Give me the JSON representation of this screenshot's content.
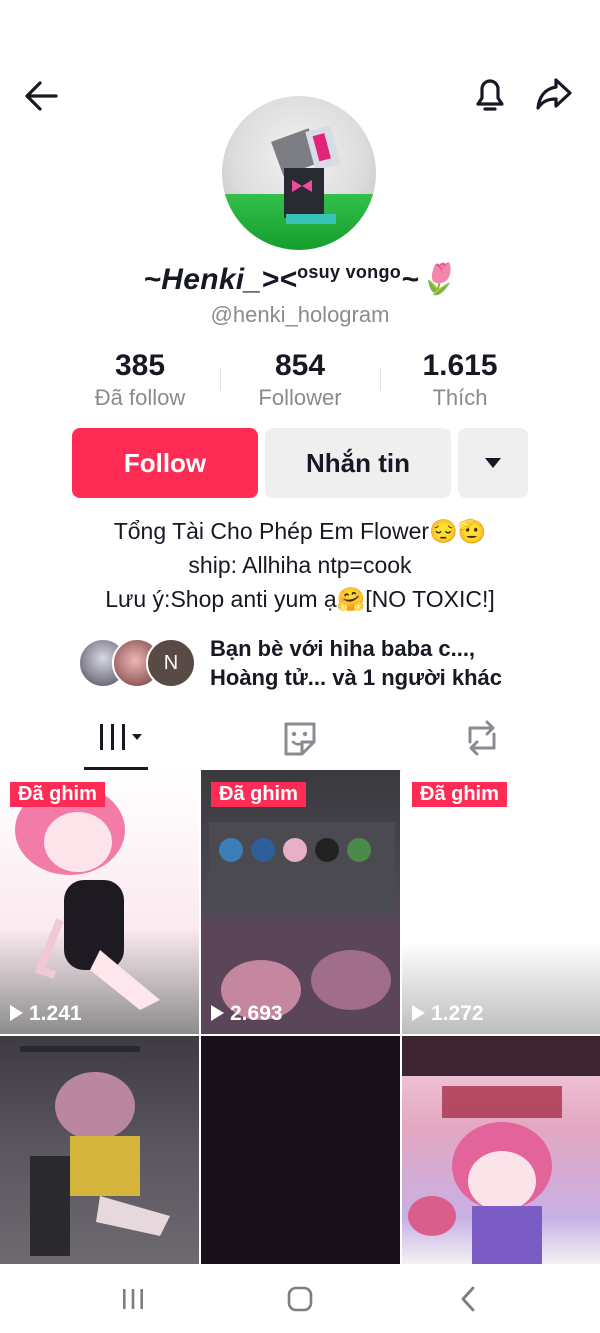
{
  "profile": {
    "display_name": "~Henki_><",
    "display_name_sup": "osuy vongo",
    "display_name_tail": "~🌷",
    "handle": "@henki_hologram"
  },
  "stats": [
    {
      "value": "385",
      "label": "Đã follow"
    },
    {
      "value": "854",
      "label": "Follower"
    },
    {
      "value": "1.615",
      "label": "Thích"
    }
  ],
  "actions": {
    "follow_label": "Follow",
    "message_label": "Nhắn tin"
  },
  "bio": {
    "line1": "Tổng Tài Cho Phép Em Flower😔🫡",
    "line2": "ship: Allhiha ntp=cook",
    "line3": "Lưu ý:Shop anti yum ạ🤗[NO TOXIC!]"
  },
  "friends": {
    "avatar_initial": "N",
    "line1": "Bạn bè với hiha baba c...,",
    "line2": "Hoàng tử... và 1 người khác"
  },
  "tabs": [
    {
      "icon": "grid-icon"
    },
    {
      "icon": "sticker-icon"
    },
    {
      "icon": "repost-icon"
    }
  ],
  "videos": [
    {
      "pinned_label": "Đã ghim",
      "views": "1.241"
    },
    {
      "pinned_label": "Đã ghim",
      "views": "2.693"
    },
    {
      "pinned_label": "Đã ghim",
      "views": "1.272"
    },
    {
      "pinned_label": "",
      "views": ""
    },
    {
      "pinned_label": "",
      "views": ""
    },
    {
      "pinned_label": "",
      "views": ""
    }
  ],
  "colors": {
    "accent": "#fe2c55",
    "text": "#161823",
    "muted": "#8a8b91"
  }
}
